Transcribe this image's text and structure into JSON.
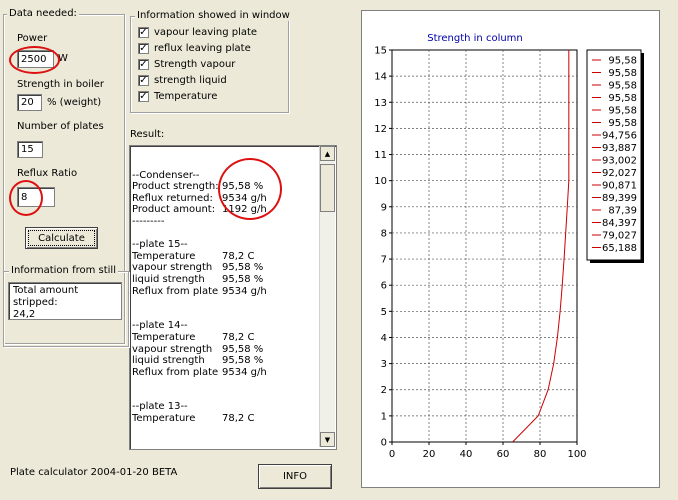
{
  "data_needed": {
    "title": "Data needed:",
    "power_label": "Power",
    "power_value": "2500",
    "power_unit": "W",
    "strength_label": "Strength in  boiler",
    "strength_value": "20",
    "strength_unit": "% (weight)",
    "plates_label": "Number of plates",
    "plates_value": "15",
    "reflux_label": "Reflux Ratio",
    "reflux_value": "8",
    "calculate_label": "Calculate"
  },
  "info_window": {
    "title": "Information showed in window",
    "options": [
      {
        "label": "vapour leaving plate",
        "checked": true
      },
      {
        "label": "reflux leaving plate",
        "checked": true
      },
      {
        "label": "Strength vapour",
        "checked": true
      },
      {
        "label": "strength liquid",
        "checked": true
      },
      {
        "label": "Temperature",
        "checked": true
      }
    ]
  },
  "still": {
    "title": "Information from still",
    "text_line1": "Total amount stripped:",
    "text_line2": "24,2"
  },
  "result": {
    "label": "Result:",
    "lines": [
      {
        "a": "",
        "b": ""
      },
      {
        "a": "--Condenser--",
        "b": ""
      },
      {
        "a": "Product strength:",
        "b": "95,58 %"
      },
      {
        "a": "Reflux returned:",
        "b": "9534 g/h"
      },
      {
        "a": "Product amount:",
        "b": "1192 g/h"
      },
      {
        "a": "---------",
        "b": ""
      },
      {
        "a": "",
        "b": ""
      },
      {
        "a": "--plate 15--",
        "b": ""
      },
      {
        "a": "Temperature",
        "b": "78,2  C"
      },
      {
        "a": "vapour strength",
        "b": "95,58 %"
      },
      {
        "a": "liquid strength",
        "b": "95,58 %"
      },
      {
        "a": "Reflux from plate",
        "b": "9534 g/h"
      },
      {
        "a": "",
        "b": ""
      },
      {
        "a": "",
        "b": ""
      },
      {
        "a": "--plate 14--",
        "b": ""
      },
      {
        "a": "Temperature",
        "b": "78,2  C"
      },
      {
        "a": "vapour strength",
        "b": "95,58 %"
      },
      {
        "a": "liquid strength",
        "b": "95,58 %"
      },
      {
        "a": "Reflux from plate",
        "b": "9534 g/h"
      },
      {
        "a": "",
        "b": ""
      },
      {
        "a": "",
        "b": ""
      },
      {
        "a": "--plate 13--",
        "b": ""
      },
      {
        "a": "Temperature",
        "b": "78,2  C"
      }
    ]
  },
  "footer": {
    "version_text": "Plate calculator 2004-01-20 BETA",
    "info_label": "INFO"
  },
  "colors": {
    "series": "#cc0000",
    "chart_title": "#0000aa",
    "annotation": "#dd1111"
  },
  "chart_data": {
    "type": "line",
    "title": "Strength in column",
    "xlim": [
      0,
      100
    ],
    "ylim": [
      0,
      15
    ],
    "xticks": [
      0,
      20,
      40,
      60,
      80,
      100
    ],
    "yticks": [
      0,
      1,
      2,
      3,
      4,
      5,
      6,
      7,
      8,
      9,
      10,
      11,
      12,
      13,
      14,
      15
    ],
    "grid": true,
    "legend_position": "right",
    "series": [
      {
        "x": [
          65.188,
          79.027,
          84.397,
          87.39,
          89.399,
          90.871,
          92.027,
          93.002,
          93.887,
          94.756,
          95.58,
          95.58,
          95.58,
          95.58,
          95.58,
          95.58
        ],
        "y": [
          0,
          1,
          2,
          3,
          4,
          5,
          6,
          7,
          8,
          9,
          10,
          11,
          12,
          13,
          14,
          15
        ]
      }
    ],
    "legend_entries": [
      "95,58",
      "95,58",
      "95,58",
      "95,58",
      "95,58",
      "95,58",
      "94,756",
      "93,887",
      "93,002",
      "92,027",
      "90,871",
      "89,399",
      "87,39",
      "84,397",
      "79,027",
      "65,188"
    ]
  }
}
